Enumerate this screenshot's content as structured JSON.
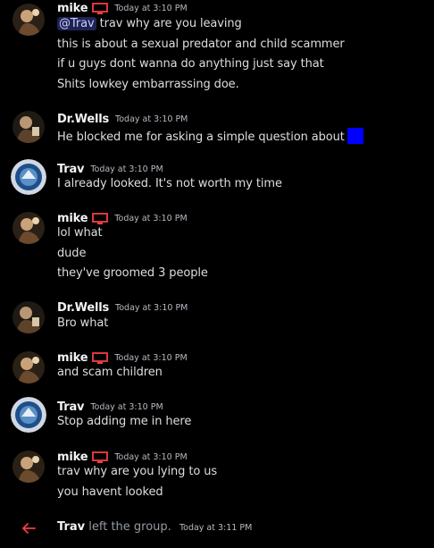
{
  "messages": [
    {
      "author": "mike",
      "has_flag": true,
      "time": "Today at 3:10 PM",
      "mention": "@Trav",
      "lines": [
        "trav why are you leaving",
        "this is about a sexual predator and child scammer",
        "if u guys dont wanna do anything just say that",
        "Shits lowkey embarrassing doe."
      ]
    },
    {
      "author": "Dr.Wells",
      "has_flag": false,
      "time": "Today at 3:10 PM",
      "lines": [
        "He blocked me for asking a simple question about"
      ]
    },
    {
      "author": "Trav",
      "has_flag": false,
      "time": "Today at 3:10 PM",
      "lines": [
        "I already looked. It's not worth my time"
      ]
    },
    {
      "author": "mike",
      "has_flag": true,
      "time": "Today at 3:10 PM",
      "lines": [
        "lol what",
        "dude",
        "they've groomed 3 people"
      ]
    },
    {
      "author": "Dr.Wells",
      "has_flag": false,
      "time": "Today at 3:10 PM",
      "lines": [
        "Bro what"
      ]
    },
    {
      "author": "mike",
      "has_flag": true,
      "time": "Today at 3:10 PM",
      "lines": [
        "and scam children"
      ]
    },
    {
      "author": "Trav",
      "has_flag": false,
      "time": "Today at 3:10 PM",
      "lines": [
        "Stop adding me in here"
      ]
    },
    {
      "author": "mike",
      "has_flag": true,
      "time": "Today at 3:10 PM",
      "lines": [
        "trav why are you lying to us",
        "you havent looked"
      ]
    }
  ],
  "system": {
    "user": "Trav",
    "action": "left the group.",
    "time": "Today at 3:11 PM",
    "icon": "left-arrow-icon"
  },
  "colors": {
    "background": "#000000",
    "mention_bg": "#3c428f",
    "redaction": "#0000ff",
    "leave_arrow": "#f23f43",
    "flag_icon": "#f23f43"
  }
}
